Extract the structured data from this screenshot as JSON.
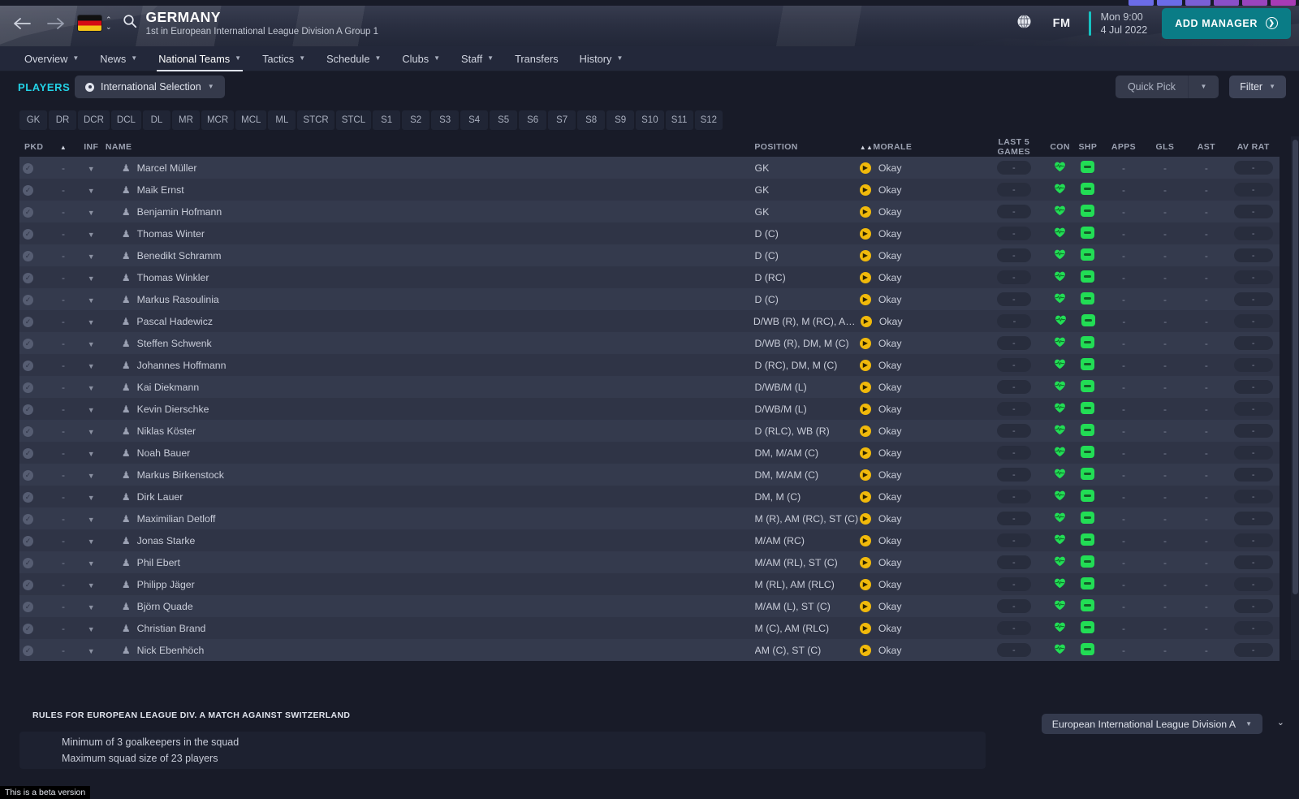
{
  "header": {
    "back_icon": "arrow-left-icon",
    "forward_icon": "arrow-right-icon",
    "flag": "germany-flag",
    "search_icon": "search-icon",
    "title": "GERMANY",
    "subtitle": "1st in European International League Division A Group 1",
    "globe_icon": "globe-icon",
    "fm_logo": "FM",
    "date_line1": "Mon 9:00",
    "date_line2": "4 Jul 2022",
    "add_manager_label": "ADD MANAGER",
    "accent_teal": "#0a7c86",
    "accent_cyan": "#16c2c2"
  },
  "menu": {
    "items": [
      {
        "label": "Overview",
        "caret": true,
        "active": false
      },
      {
        "label": "News",
        "caret": true,
        "active": false
      },
      {
        "label": "National Teams",
        "caret": true,
        "active": true
      },
      {
        "label": "Tactics",
        "caret": true,
        "active": false
      },
      {
        "label": "Schedule",
        "caret": true,
        "active": false
      },
      {
        "label": "Clubs",
        "caret": true,
        "active": false
      },
      {
        "label": "Staff",
        "caret": true,
        "active": false
      },
      {
        "label": "Transfers",
        "caret": false,
        "active": false
      },
      {
        "label": "History",
        "caret": true,
        "active": false
      }
    ]
  },
  "toolbar": {
    "section_label": "PLAYERS",
    "selection_label": "International Selection",
    "quick_pick_label": "Quick Pick",
    "filter_label": "Filter",
    "section_color": "#23d2e6"
  },
  "position_chips": [
    "GK",
    "DR",
    "DCR",
    "DCL",
    "DL",
    "MR",
    "MCR",
    "MCL",
    "ML",
    "STCR",
    "STCL",
    "S1",
    "S2",
    "S3",
    "S4",
    "S5",
    "S6",
    "S7",
    "S8",
    "S9",
    "S10",
    "S11",
    "S12"
  ],
  "table": {
    "columns": [
      {
        "key": "pkd",
        "label": "PKD"
      },
      {
        "key": "sort",
        "label": ""
      },
      {
        "key": "inf",
        "label": "INF"
      },
      {
        "key": "name",
        "label": "NAME"
      },
      {
        "key": "pos",
        "label": "POSITION"
      },
      {
        "key": "mor",
        "label": "MORALE"
      },
      {
        "key": "l5",
        "label": "LAST 5 GAMES"
      },
      {
        "key": "con",
        "label": "CON"
      },
      {
        "key": "shp",
        "label": "SHP"
      },
      {
        "key": "apps",
        "label": "APPS"
      },
      {
        "key": "gls",
        "label": "GLS"
      },
      {
        "key": "ast",
        "label": "AST"
      },
      {
        "key": "avrat",
        "label": "AV RAT"
      }
    ],
    "sort_indicator": "▲",
    "morale_sort_indicator": "▲▲",
    "empty_value": "-",
    "rows": [
      {
        "name": "Marcel Müller",
        "position": "GK",
        "morale": "Okay"
      },
      {
        "name": "Maik Ernst",
        "position": "GK",
        "morale": "Okay"
      },
      {
        "name": "Benjamin Hofmann",
        "position": "GK",
        "morale": "Okay"
      },
      {
        "name": "Thomas Winter",
        "position": "D (C)",
        "morale": "Okay"
      },
      {
        "name": "Benedikt Schramm",
        "position": "D (C)",
        "morale": "Okay"
      },
      {
        "name": "Thomas Winkler",
        "position": "D (RC)",
        "morale": "Okay"
      },
      {
        "name": "Markus Rasoulinia",
        "position": "D (C)",
        "morale": "Okay"
      },
      {
        "name": "Pascal Hadewicz",
        "position": "D/WB (R), M (RC), AM...",
        "morale": "Okay"
      },
      {
        "name": "Steffen Schwenk",
        "position": "D/WB (R), DM, M (C)",
        "morale": "Okay"
      },
      {
        "name": "Johannes Hoffmann",
        "position": "D (RC), DM, M (C)",
        "morale": "Okay"
      },
      {
        "name": "Kai Diekmann",
        "position": "D/WB/M (L)",
        "morale": "Okay"
      },
      {
        "name": "Kevin Dierschke",
        "position": "D/WB/M (L)",
        "morale": "Okay"
      },
      {
        "name": "Niklas Köster",
        "position": "D (RLC), WB (R)",
        "morale": "Okay"
      },
      {
        "name": "Noah Bauer",
        "position": "DM, M/AM (C)",
        "morale": "Okay"
      },
      {
        "name": "Markus Birkenstock",
        "position": "DM, M/AM (C)",
        "morale": "Okay"
      },
      {
        "name": "Dirk Lauer",
        "position": "DM, M (C)",
        "morale": "Okay"
      },
      {
        "name": "Maximilian Detloff",
        "position": "M (R), AM (RC), ST (C)",
        "morale": "Okay"
      },
      {
        "name": "Jonas Starke",
        "position": "M/AM (RC)",
        "morale": "Okay"
      },
      {
        "name": "Phil Ebert",
        "position": "M/AM (RL), ST (C)",
        "morale": "Okay"
      },
      {
        "name": "Philipp Jäger",
        "position": "M (RL), AM (RLC)",
        "morale": "Okay"
      },
      {
        "name": "Björn Quade",
        "position": "M/AM (L), ST (C)",
        "morale": "Okay"
      },
      {
        "name": "Christian Brand",
        "position": "M (C), AM (RLC)",
        "morale": "Okay"
      },
      {
        "name": "Nick Ebenhöch",
        "position": "AM (C), ST (C)",
        "morale": "Okay"
      }
    ]
  },
  "footer": {
    "rules_title": "RULES FOR EUROPEAN LEAGUE DIV. A MATCH AGAINST SWITZERLAND",
    "rules": [
      "Minimum of 3 goalkeepers in the squad",
      "Maximum squad size of 23 players"
    ],
    "competition_select": "European International League Division A",
    "beta_note": "This is a beta version"
  },
  "decor": {
    "strip_colors": [
      "#6b6ce8",
      "#6b6ce8",
      "#7a5fd6",
      "#8a4fc8",
      "#9a44bd",
      "#a83ab5"
    ]
  }
}
